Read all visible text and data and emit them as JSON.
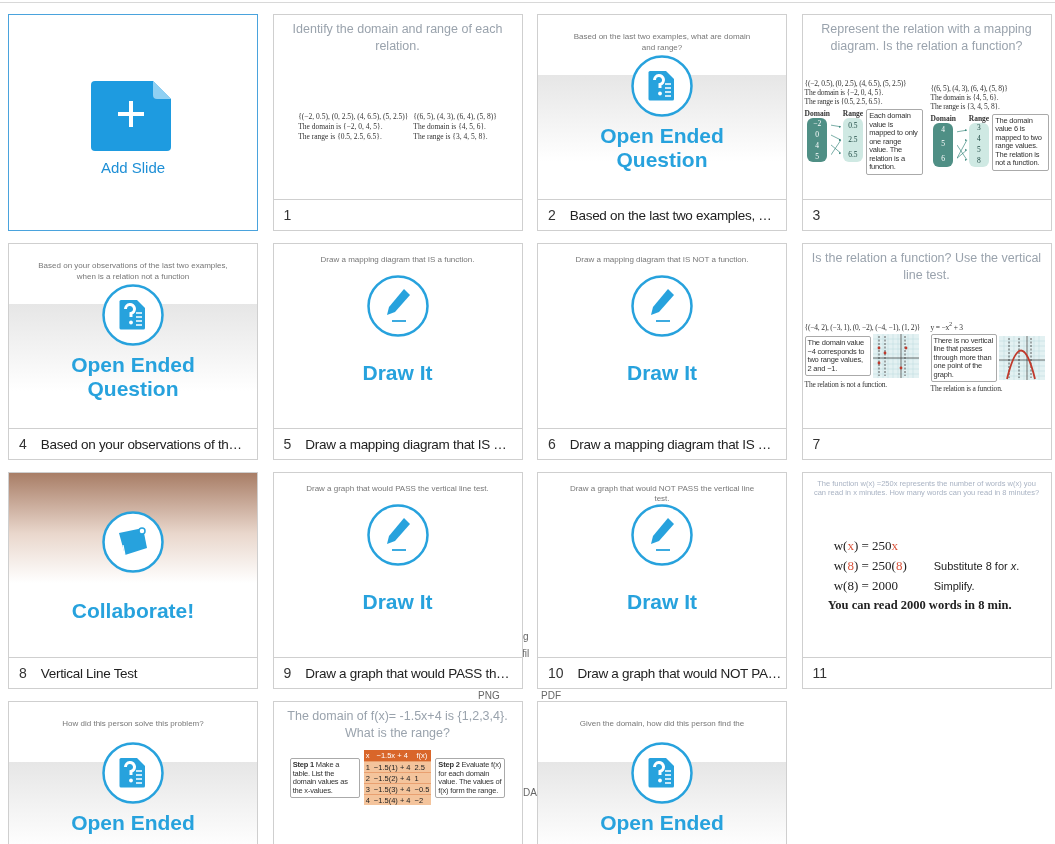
{
  "add_slide": {
    "label": "Add Slide"
  },
  "background_fragments": [
    {
      "text": "g"
    },
    {
      "text": "fil"
    },
    {
      "text": "PNG"
    },
    {
      "text": "PDF"
    },
    {
      "text": "DA"
    }
  ],
  "slides": [
    {
      "number": "1",
      "kind": "content",
      "title": "Identify the domain and range of each relation.",
      "blocks": [
        {
          "kind": "text",
          "lines": [
            "{(−2, 0.5), (0, 2.5), (4, 6.5), (5, 2.5)}",
            "The domain is {−2, 0, 4, 5}.",
            "The range is {0.5, 2.5, 6.5}."
          ]
        },
        {
          "kind": "text",
          "lines": [
            "{(6, 5), (4, 3), (6, 4), (5, 8)}",
            "The domain is {4, 5, 6}.",
            "The range is {3, 4, 5, 8}."
          ]
        }
      ]
    },
    {
      "number": "2",
      "caption": "Based on the last two examples, …",
      "kind": "open_ended",
      "prompt": "Based on the last two examples, what are domain and range?",
      "heading": "Open Ended Question"
    },
    {
      "number": "3",
      "kind": "content",
      "title": "Represent the relation with a mapping diagram. Is the relation a function?",
      "blocks": [
        {
          "kind": "mapping",
          "lines": [
            "{(−2, 0.5), (0, 2.5), (4, 6.5), (5, 2.5)}",
            "The domain is {−2, 0, 4, 5}.",
            "The range is {0.5, 2.5, 6.5}."
          ],
          "domain_header": "Domain",
          "range_header": "Range",
          "domain": [
            "−2",
            "0",
            "4",
            "5"
          ],
          "range": [
            "0.5",
            "2.5",
            "6.5"
          ],
          "note": "Each domain value is mapped to only one range value. The relation is a function."
        },
        {
          "kind": "mapping",
          "lines": [
            "{(6, 5), (4, 3), (6, 4), (5, 8)}",
            "The domain is {4, 5, 6}.",
            "The range is {3, 4, 5, 8}."
          ],
          "domain_header": "Domain",
          "range_header": "Range",
          "domain": [
            "4",
            "5",
            "6"
          ],
          "range": [
            "3",
            "4",
            "5",
            "8"
          ],
          "note": "The domain value 6 is mapped to two range values. The relation is not a function."
        }
      ]
    },
    {
      "number": "4",
      "caption": "Based on your observations of th…",
      "kind": "open_ended",
      "prompt": "Based on your observations of the last two examples, when is a relation not a function",
      "heading": "Open Ended Question"
    },
    {
      "number": "5",
      "caption": "Draw a mapping diagram that IS …",
      "kind": "draw_it",
      "prompt": "Draw a mapping diagram that IS a function.",
      "heading": "Draw It"
    },
    {
      "number": "6",
      "caption": "Draw a mapping diagram that IS …",
      "kind": "draw_it",
      "prompt": "Draw a mapping diagram that IS NOT a function.",
      "heading": "Draw It"
    },
    {
      "number": "7",
      "kind": "content",
      "title": "Is the relation a function? Use the vertical line test.",
      "blocks": [
        {
          "kind": "graph",
          "equation": "{(−4, 2), (−3, 1), (0, −2), (−4, −1), (1, 2)}",
          "note": "The domain value −4 corresponds to two range values, 2 and −1.",
          "conclusion": "The relation is not a function."
        },
        {
          "kind": "graph",
          "equation": "y = −x$^{2}$ + 3",
          "note": "There is no vertical line that passes through more than one point of the graph.",
          "conclusion": "The relation is a function."
        }
      ]
    },
    {
      "number": "8",
      "caption": "Vertical Line Test",
      "kind": "collaborate",
      "heading": "Collaborate!"
    },
    {
      "number": "9",
      "caption": "Draw a graph that would PASS th…",
      "kind": "draw_it",
      "prompt": "Draw a graph that would PASS the vertical line test.",
      "heading": "Draw It"
    },
    {
      "number": "10",
      "caption": "Draw a graph that would NOT PA…",
      "kind": "draw_it",
      "prompt": "Draw a graph that would NOT PASS the vertical line test.",
      "heading": "Draw It"
    },
    {
      "number": "11",
      "kind": "content",
      "instructions": "The function w(x) =250x represents the number of words w(x) you can read in x minutes. How many words can you read in 8 minutes?",
      "blocks": [
        {
          "kind": "equations",
          "lines": [
            {
              "parts": [
                {
                  "text": "w(",
                  "highlight": false
                },
                {
                  "text": "x",
                  "highlight": true
                },
                {
                  "text": ") = 250",
                  "highlight": false
                },
                {
                  "text": "x",
                  "highlight": true
                }
              ]
            },
            {
              "parts": [
                {
                  "text": "w(",
                  "highlight": false
                },
                {
                  "text": "8",
                  "highlight": true
                },
                {
                  "text": ") = 250(",
                  "highlight": false
                },
                {
                  "text": "8",
                  "highlight": true
                },
                {
                  "text": ")",
                  "highlight": false
                }
              ],
              "note": "Substitute 8 for *x*."
            },
            {
              "parts": [
                {
                  "text": "w(8) = 2000",
                  "highlight": false
                }
              ],
              "note": "Simplify."
            }
          ],
          "conclusion": "You can read 2000 words in 8 min."
        }
      ]
    },
    {
      "kind": "open_ended",
      "prompt": "How did this person solve this problem?",
      "heading": "Open Ended"
    },
    {
      "kind": "content",
      "title": "The domain of f(x)= -1.5x+4 is {1,2,3,4}. What is the range?",
      "blocks": [
        {
          "kind": "callout",
          "text": "**Step 1** Make a table. List the domain values as the x-values."
        },
        {
          "kind": "table",
          "columns": [
            "x",
            "−1.5x + 4",
            "f(x)"
          ],
          "rows": [
            [
              "1",
              "−1.5(1) + 4",
              "2.5"
            ],
            [
              "2",
              "−1.5(2) + 4",
              "1"
            ],
            [
              "3",
              "−1.5(3) + 4",
              "−0.5"
            ],
            [
              "4",
              "−1.5(4) + 4",
              "−2"
            ]
          ]
        },
        {
          "kind": "callout",
          "text": "**Step 2** Evaluate f(x) for each domain value. The values of f(x) form the range."
        }
      ]
    },
    {
      "kind": "open_ended",
      "prompt": "Given the domain, how did this person find the",
      "heading": "Open Ended"
    }
  ]
}
